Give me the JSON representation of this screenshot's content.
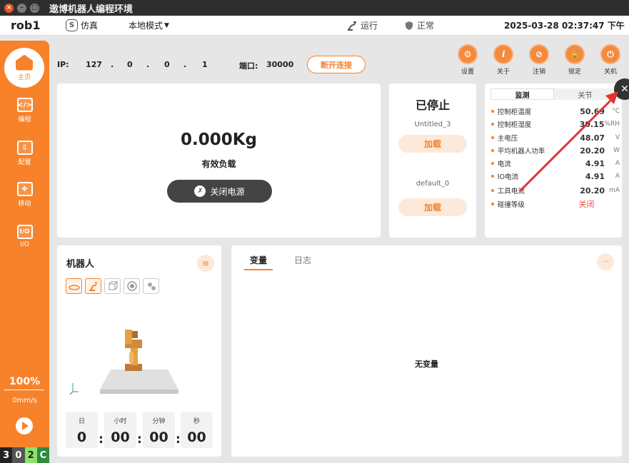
{
  "window": {
    "title": "遨博机器人编程环境",
    "close": "×",
    "min": "–",
    "max": "□"
  },
  "topbar": {
    "robot_name": "rob1",
    "sim_icon": "S",
    "sim_label": "仿真",
    "mode": "本地模式",
    "mode_arrow": "▼",
    "run_label": "运行",
    "normal_label": "正常",
    "datetime": "2025-03-28 02:37:47 下午"
  },
  "sidebar": {
    "home": "主页",
    "items": [
      {
        "icon": "</>",
        "label": "编程"
      },
      {
        "icon": "⇩",
        "label": "配置"
      },
      {
        "icon": "✥",
        "label": "移动"
      },
      {
        "icon": "I/O",
        "label": "I/O"
      }
    ],
    "speed": "100%",
    "velocity": "0mm/s",
    "counters": [
      "3",
      "0",
      "2",
      "C"
    ],
    "counter_colors": [
      "#222222",
      "#555555",
      "#8ee06a",
      "#2e8b3e"
    ]
  },
  "connection": {
    "ip_label": "IP:",
    "ip": [
      "127",
      ".",
      "0",
      ".",
      "0",
      ".",
      "1"
    ],
    "port_label": "端口:",
    "port": "30000",
    "disconnect": "断开连接"
  },
  "tools": [
    {
      "icon": "⚙",
      "label": "设置"
    },
    {
      "icon": "i",
      "label": "关于"
    },
    {
      "icon": "⊘",
      "label": "注销"
    },
    {
      "icon": "🔒",
      "label": "锁定"
    },
    {
      "icon": "⏻",
      "label": "关机"
    }
  ],
  "payload": {
    "value": "0.000Kg",
    "label": "有效负载",
    "power_icon": "✗",
    "power_button": "关闭电源"
  },
  "program": {
    "status": "已停止",
    "programs": [
      {
        "name": "Untitled_3",
        "load": "加载"
      },
      {
        "name": "default_0",
        "load": "加载"
      }
    ]
  },
  "monitor": {
    "tabs": [
      "监测",
      "关节"
    ],
    "rows": [
      {
        "label": "控制柜温度",
        "value": "50.69",
        "unit": "°C"
      },
      {
        "label": "控制柜湿度",
        "value": "30.15",
        "unit": "%RH"
      },
      {
        "label": "主电压",
        "value": "48.07",
        "unit": "V"
      },
      {
        "label": "平均机器人功率",
        "value": "20.20",
        "unit": "W"
      },
      {
        "label": "电流",
        "value": "4.91",
        "unit": "A"
      },
      {
        "label": "IO电流",
        "value": "4.91",
        "unit": "A"
      },
      {
        "label": "工具电流",
        "value": "20.20",
        "unit": "mA"
      },
      {
        "label": "碰撞等级",
        "value": "关闭",
        "unit": ""
      }
    ],
    "wrench_icon": "✕"
  },
  "robot_panel": {
    "title": "机器人",
    "list_icon": "≡",
    "timer_labels": [
      "日",
      "小时",
      "分钟",
      "秒"
    ],
    "timer_values": [
      "0",
      "00",
      "00",
      "00"
    ],
    "colon": ":"
  },
  "variables": {
    "tabs": [
      "变量",
      "日志"
    ],
    "more_icon": "···",
    "empty": "无变量"
  }
}
